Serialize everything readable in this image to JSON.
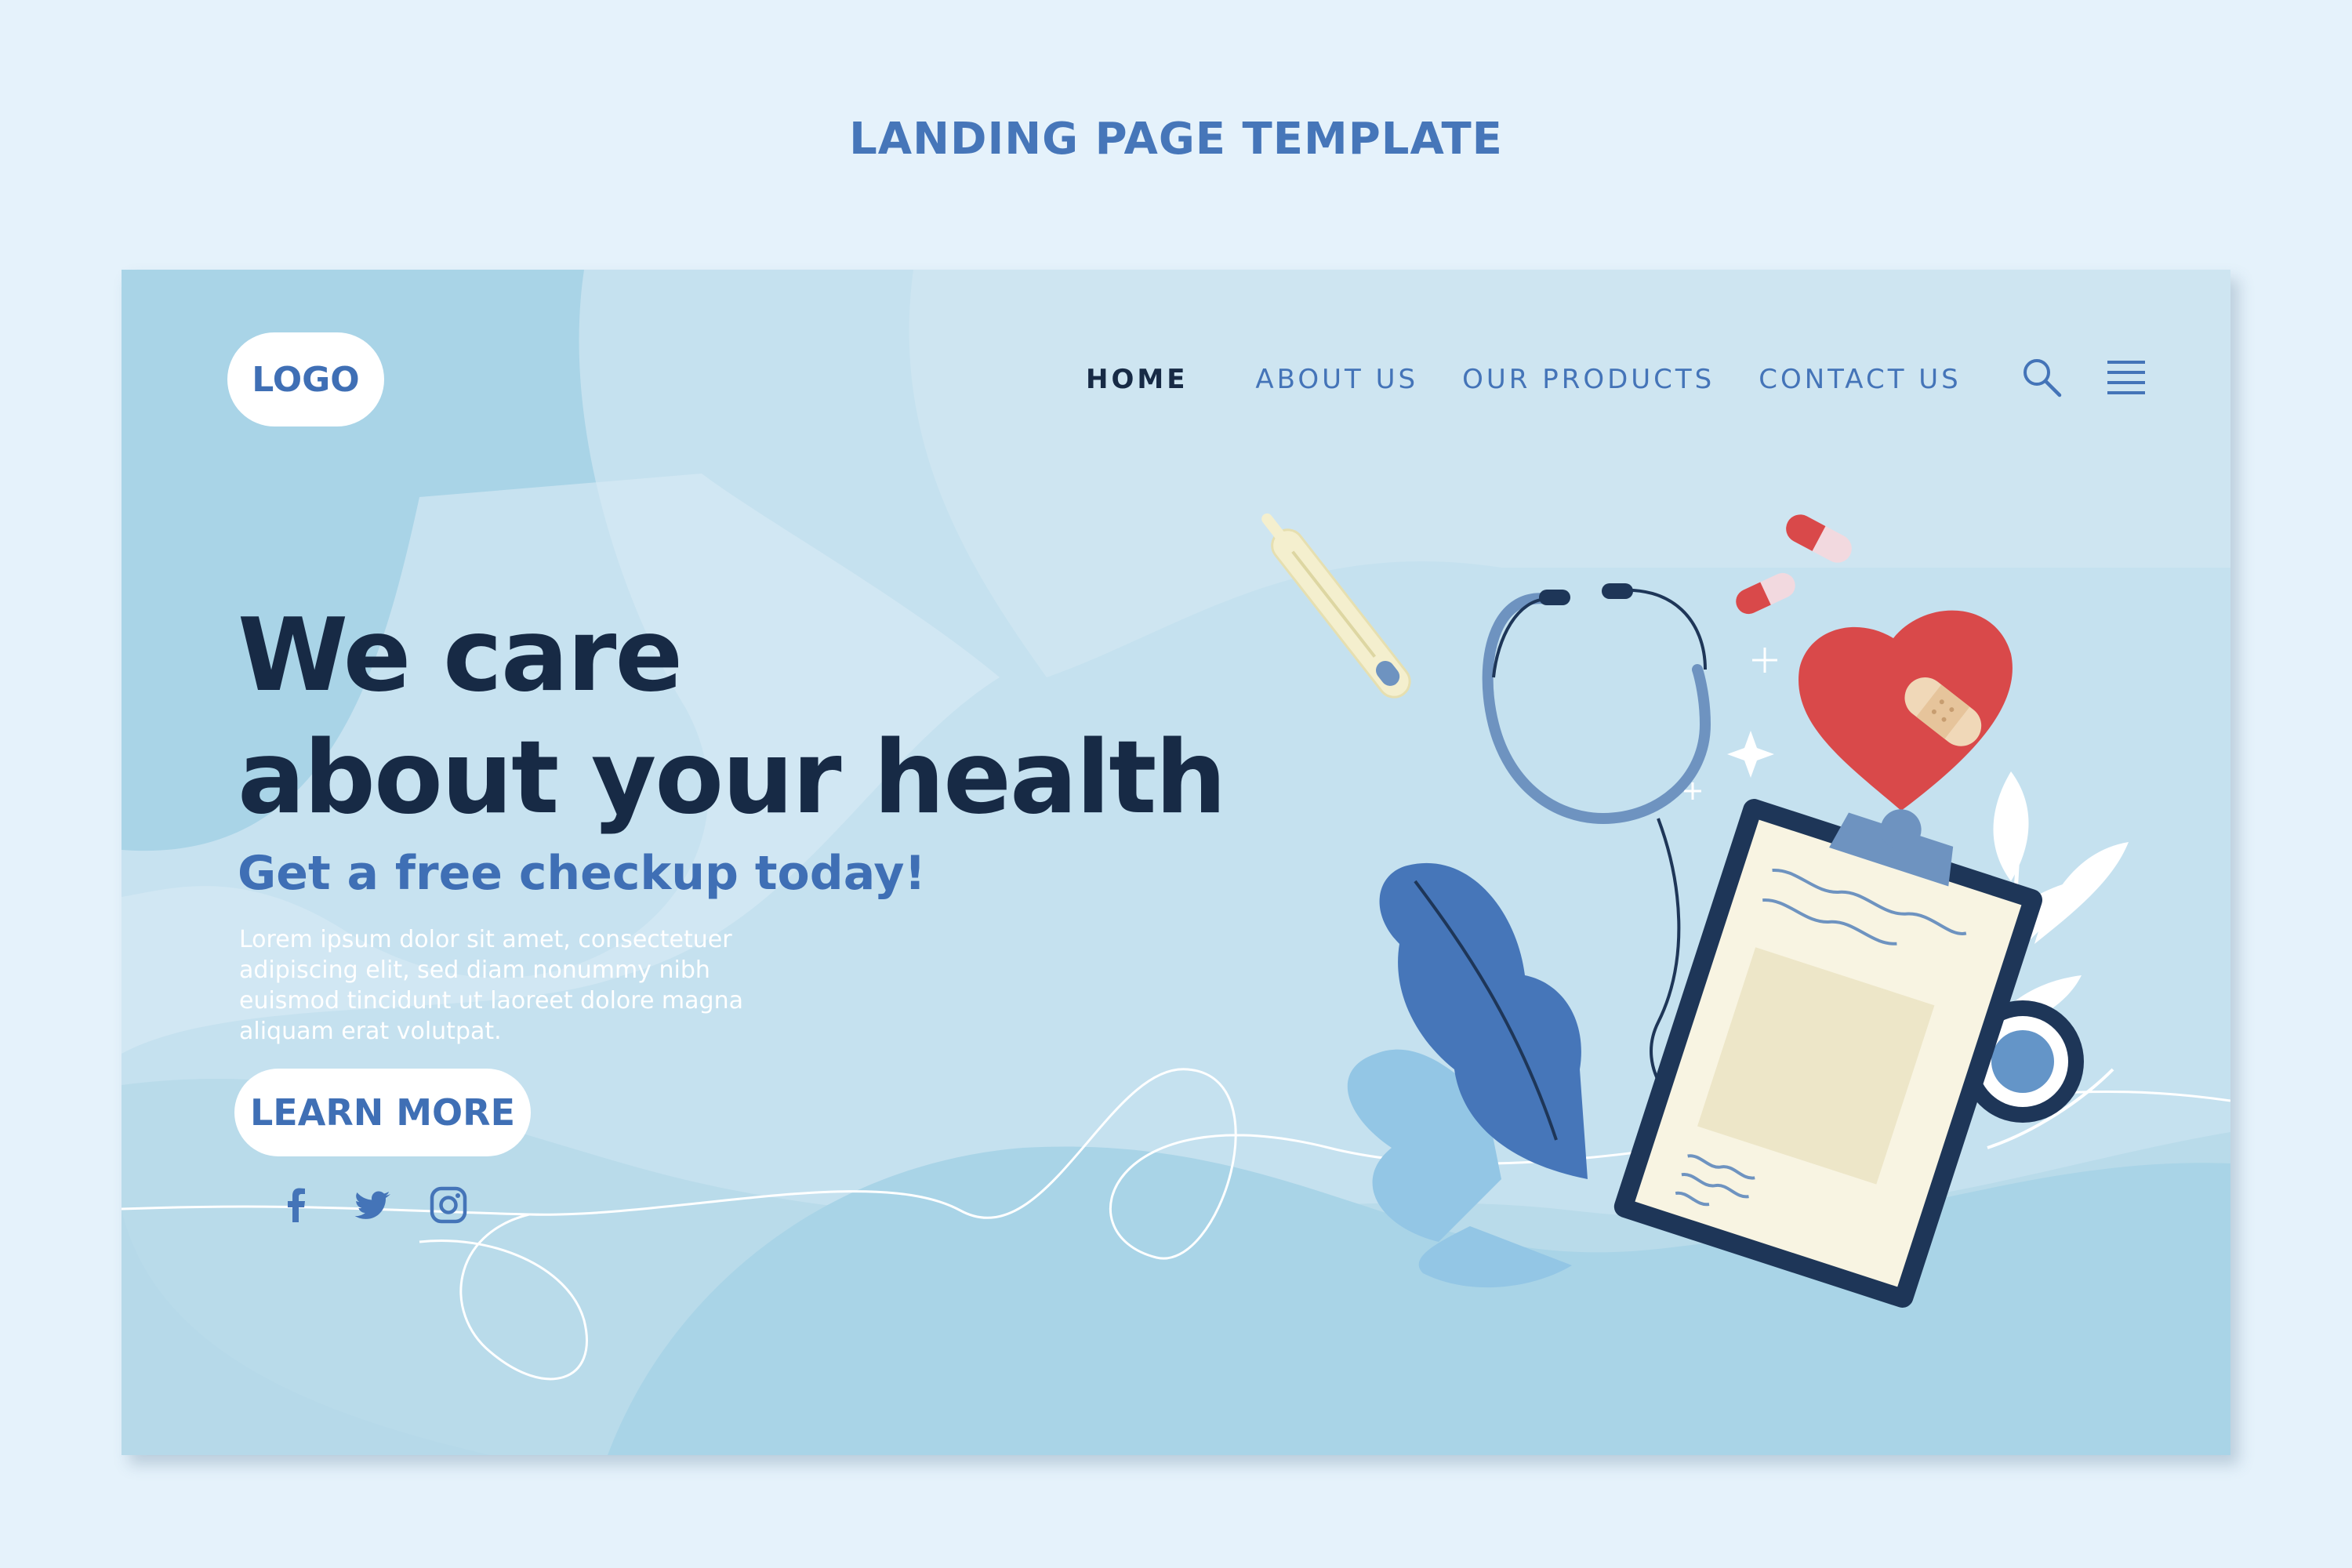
{
  "page_heading": "LANDING PAGE TEMPLATE",
  "header": {
    "logo_text": "LOGO",
    "nav": {
      "home": "HOME",
      "about": "ABOUT US",
      "products": "OUR PRODUCTS",
      "contact": "CONTACT US"
    },
    "icons": [
      "search-icon",
      "hamburger-menu-icon"
    ]
  },
  "hero": {
    "title_line1": "We care",
    "title_line2": "about your health",
    "subtitle": "Get a free checkup today!",
    "body_lines": [
      "Lorem ipsum dolor sit amet, consectetuer",
      "adipiscing elit, sed diam nonummy nibh",
      "euismod tincidunt ut laoreet dolore magna",
      "aliquam erat volutpat."
    ],
    "cta_label": "LEARN MORE"
  },
  "social_icons": [
    "facebook-icon",
    "twitter-icon",
    "instagram-icon"
  ],
  "illustration": [
    "stethoscope",
    "thermometer",
    "clipboard",
    "heart-with-bandage",
    "pills",
    "leaves"
  ],
  "colors": {
    "page_background": "#e5f2fb",
    "card_background": "#c5e1ef",
    "accent_blue": "#3f6fb5",
    "heading_navy": "#172a45",
    "heart_red": "#d9494a"
  }
}
